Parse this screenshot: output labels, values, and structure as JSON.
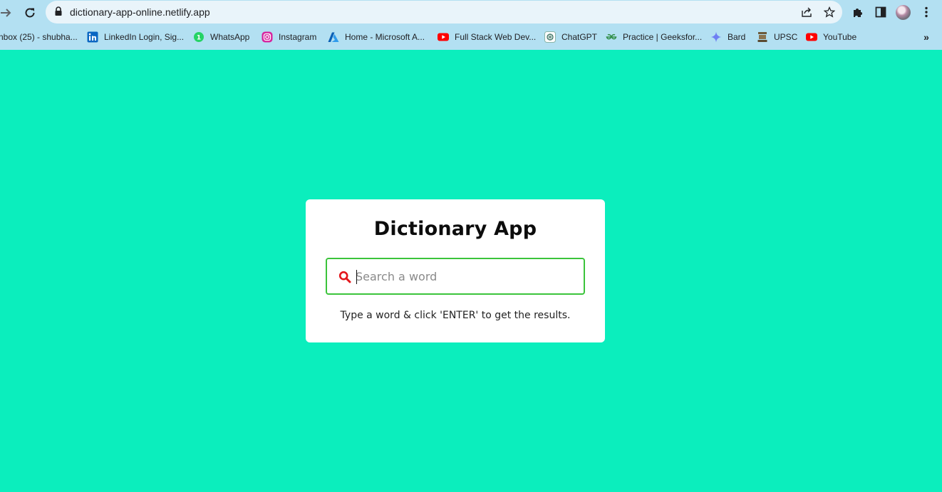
{
  "browser": {
    "url": "dictionary-app-online.netlify.app"
  },
  "bookmarks": [
    {
      "label": "nbox (25) - shubha...",
      "icon": "gmail-icon"
    },
    {
      "label": "LinkedIn Login, Sig...",
      "icon": "linkedin-icon"
    },
    {
      "label": "WhatsApp",
      "icon": "whatsapp-icon"
    },
    {
      "label": "Instagram",
      "icon": "instagram-icon"
    },
    {
      "label": "Home - Microsoft A...",
      "icon": "azure-icon"
    },
    {
      "label": "Full Stack Web Dev...",
      "icon": "youtube-icon"
    },
    {
      "label": "ChatGPT",
      "icon": "chatgpt-icon"
    },
    {
      "label": "Practice | Geeksfor...",
      "icon": "geeksforgeeks-icon"
    },
    {
      "label": "Bard",
      "icon": "bard-icon"
    },
    {
      "label": "UPSC",
      "icon": "upsc-emblem-icon"
    },
    {
      "label": "YouTube",
      "icon": "youtube-icon"
    }
  ],
  "bookmarks_overflow": "»",
  "app": {
    "title": "Dictionary App",
    "search_placeholder": "Search a word",
    "search_value": "",
    "hint": "Type a word & click 'ENTER' to get the results."
  },
  "colors": {
    "page_background": "#0beebd",
    "chrome_background": "#b3e0f2",
    "search_border": "#3bc43b",
    "search_icon": "#e3161b"
  }
}
